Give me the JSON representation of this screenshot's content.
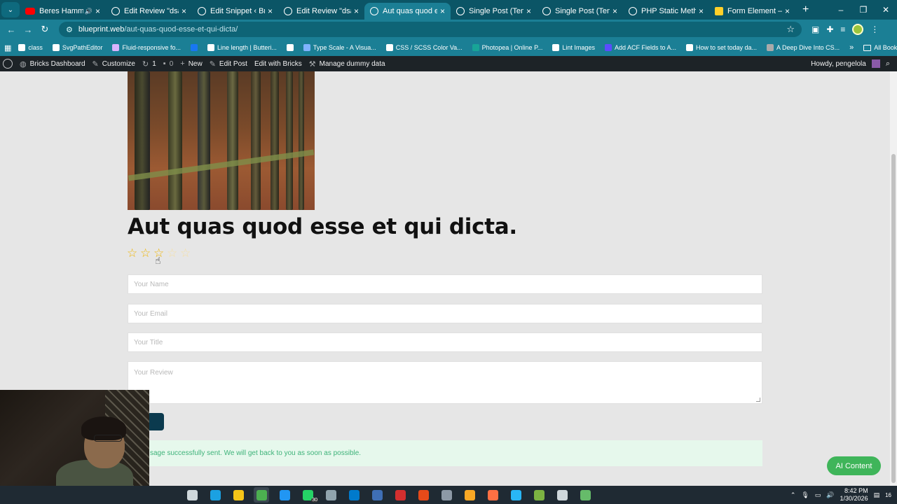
{
  "browser": {
    "tabs": [
      {
        "title": "Beres Hammond",
        "icon": "youtube-icon",
        "active": false,
        "audio": true
      },
      {
        "title": "Edit Review \"dsada\"",
        "icon": "wordpress-icon",
        "active": false
      },
      {
        "title": "Edit Snippet ‹ Bricks",
        "icon": "wordpress-icon",
        "active": false
      },
      {
        "title": "Edit Review \"dsada\"",
        "icon": "wordpress-icon",
        "active": false
      },
      {
        "title": "Aut quas quod esse",
        "icon": "wordpress-icon",
        "active": true
      },
      {
        "title": "Single Post (Template",
        "icon": "wordpress-icon",
        "active": false
      },
      {
        "title": "Single Post (Template",
        "icon": "wordpress-icon",
        "active": false
      },
      {
        "title": "PHP Static Method E",
        "icon": "openai-icon",
        "active": false
      },
      {
        "title": "Form Element – Brick",
        "icon": "bricks-icon",
        "active": false
      }
    ],
    "url_domain": "blueprint.web",
    "url_path": "/aut-quas-quod-esse-et-qui-dicta/"
  },
  "bookmarks": [
    {
      "label": "class",
      "color": "#ffffff"
    },
    {
      "label": "SvgPathEditor",
      "color": "#ffffff"
    },
    {
      "label": "Fluid-responsive fo...",
      "color": "#d9b3ff"
    },
    {
      "label": "",
      "color": "#1877f2"
    },
    {
      "label": "Line length | Butteri...",
      "color": "#ffffff"
    },
    {
      "label": "",
      "color": "#ffffff"
    },
    {
      "label": "Type Scale - A Visua...",
      "color": "#7fb3ff"
    },
    {
      "label": "CSS / SCSS Color Va...",
      "color": "#ffffff"
    },
    {
      "label": "Photopea | Online P...",
      "color": "#18a497"
    },
    {
      "label": "Lint Images",
      "color": "#ffffff"
    },
    {
      "label": "Add ACF Fields to A...",
      "color": "#5b4cff"
    },
    {
      "label": "How to set today da...",
      "color": "#ffffff"
    },
    {
      "label": "A Deep Dive Into CS...",
      "color": "#aaaaaa"
    }
  ],
  "bookmarks_all": "All Bookmarks",
  "wpbar": {
    "dashboard": "Bricks Dashboard",
    "customize": "Customize",
    "updates": "1",
    "comments": "0",
    "new": "New",
    "edit_post": "Edit Post",
    "edit_bricks": "Edit with Bricks",
    "dummy": "Manage dummy data",
    "howdy": "Howdy, pengelola"
  },
  "post": {
    "title": "Aut quas quod esse et qui dicta.",
    "rating": 3,
    "rating_max": 5
  },
  "form": {
    "name_placeholder": "Your Name",
    "email_placeholder": "Your Email",
    "title_placeholder": "Your Title",
    "review_placeholder": "Your Review",
    "success_message": "sage successfully sent. We will get back to you as soon as possible."
  },
  "ai_button": "AI Content",
  "taskbar": {
    "whatsapp_badge": "30",
    "time": "8:42 PM",
    "date": "1/30/2026",
    "notif_count": "16"
  },
  "colors": {
    "chrome_dark": "#0b5566",
    "chrome": "#1b7f95",
    "wp_bar": "#1d2327",
    "star": "#f0b400",
    "success_bg": "#e6f8ec",
    "success_text": "#3fb37a",
    "ai_green": "#3fb55a"
  }
}
